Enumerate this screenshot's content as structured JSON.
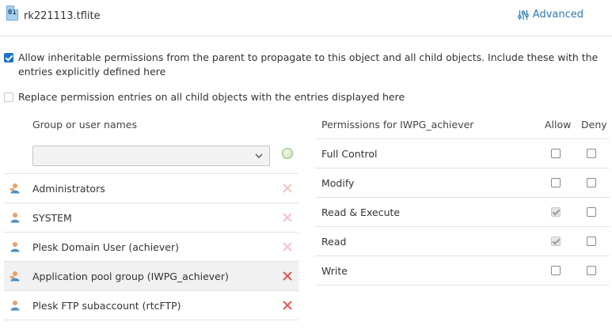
{
  "file": {
    "icon_label": "01",
    "name": "rk221113.tflite"
  },
  "toolbar": {
    "advanced_label": "Advanced"
  },
  "options": {
    "inherit": {
      "checked": true,
      "label": "Allow inheritable permissions from the parent to propagate to this object and all child objects. Include these with the entries explicitly defined here"
    },
    "replace": {
      "checked": false,
      "label": "Replace permission entries on all child objects with the entries displayed here"
    }
  },
  "groups": {
    "header": "Group or user names",
    "select_value": "",
    "users": [
      {
        "name": "Administrators",
        "icon": "admin-user-icon",
        "removable": false,
        "selected": false
      },
      {
        "name": "SYSTEM",
        "icon": "user-icon",
        "removable": false,
        "selected": false
      },
      {
        "name": "Plesk Domain User (achiever)",
        "icon": "user-icon",
        "removable": false,
        "selected": false
      },
      {
        "name": "Application pool group (IWPG_achiever)",
        "icon": "admin-user-icon",
        "removable": true,
        "selected": true
      },
      {
        "name": "Plesk FTP subaccount (rtcFTP)",
        "icon": "user-icon",
        "removable": true,
        "selected": false
      }
    ]
  },
  "permissions": {
    "header": "Permissions for IWPG_achiever",
    "allow_header": "Allow",
    "deny_header": "Deny",
    "items": [
      {
        "name": "Full Control",
        "allow": false,
        "allow_inherited": false,
        "deny": false
      },
      {
        "name": "Modify",
        "allow": false,
        "allow_inherited": false,
        "deny": false
      },
      {
        "name": "Read & Execute",
        "allow": true,
        "allow_inherited": true,
        "deny": false
      },
      {
        "name": "Read",
        "allow": true,
        "allow_inherited": true,
        "deny": false
      },
      {
        "name": "Write",
        "allow": false,
        "allow_inherited": false,
        "deny": false
      }
    ]
  },
  "colors": {
    "accent": "#1a73c8",
    "link": "#2a7ab0",
    "remove_disabled": "#f4c4c4",
    "remove_active": "#e05a5a"
  }
}
